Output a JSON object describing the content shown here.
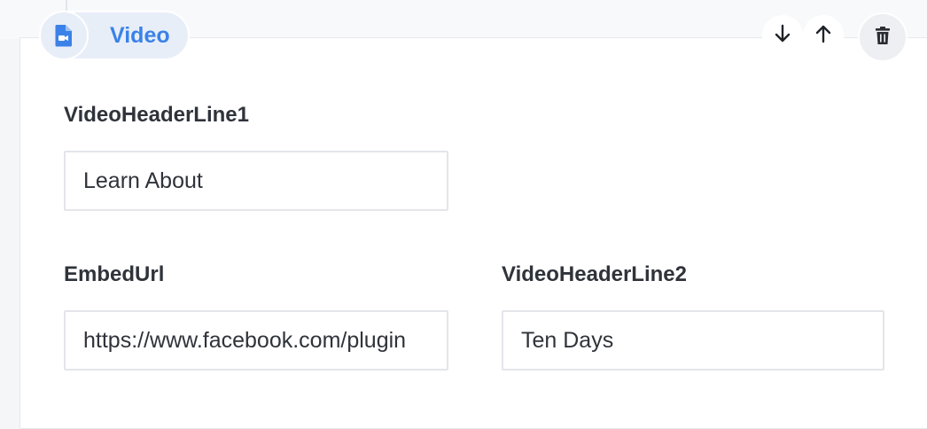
{
  "block": {
    "type_label": "Video",
    "type_icon": "video-file-icon",
    "accent_color": "#3b82e8"
  },
  "actions": {
    "move_down_icon": "arrow-down-icon",
    "move_up_icon": "arrow-up-icon",
    "delete_icon": "trash-icon"
  },
  "fields": {
    "video_header_line1": {
      "label": "VideoHeaderLine1",
      "value": "Learn About"
    },
    "embed_url": {
      "label": "EmbedUrl",
      "value": "https://www.facebook.com/plugin"
    },
    "video_header_line2": {
      "label": "VideoHeaderLine2",
      "value": "Ten Days"
    }
  }
}
